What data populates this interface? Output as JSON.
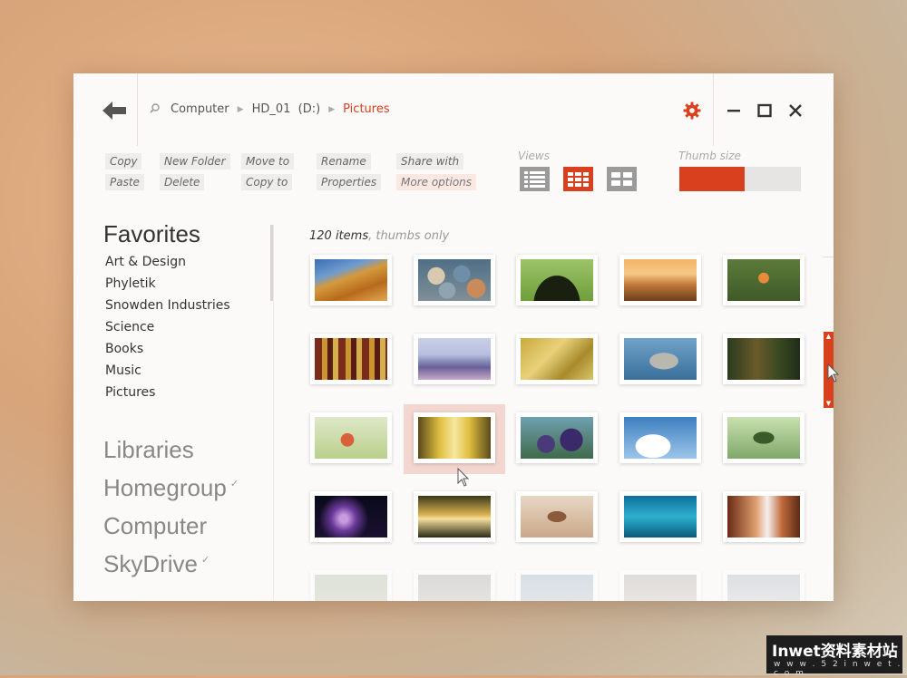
{
  "window": {
    "breadcrumb": [
      "Computer",
      "HD_01  (D:)",
      "Pictures"
    ],
    "settings_icon": "gear-icon",
    "minimize_icon": "minimize-icon",
    "maximize_icon": "maximize-icon",
    "close_icon": "close-icon",
    "back_icon": "back-arrow-icon",
    "search_icon": "search-icon"
  },
  "toolbar": {
    "copy": "Copy",
    "paste": "Paste",
    "new_folder": "New Folder",
    "delete": "Delete",
    "move_to": "Move to",
    "copy_to": "Copy to",
    "rename": "Rename",
    "properties": "Properties",
    "share_with": "Share with",
    "more_options": "More options",
    "views_label": "Views",
    "views": [
      "list-view-icon",
      "thumbs-view-icon",
      "tiles-view-icon"
    ],
    "selected_view": "thumbs-view-icon",
    "thumb_size_label": "Thumb size",
    "thumb_size_value": 0.54
  },
  "sidebar": {
    "favorites_title": "Favorites",
    "favorites": [
      "Art & Design",
      "Phyletik",
      "Snowden Industries",
      "Science",
      "Books",
      "Music",
      "Pictures"
    ],
    "locations": [
      "Libraries",
      "Homegroup",
      "Computer",
      "SkyDrive"
    ],
    "checks": [
      "",
      "✓",
      "",
      "✓"
    ]
  },
  "content": {
    "count": "120 items",
    "count_suffix": ", thumbs only",
    "selected_index": 11,
    "thumbnails": [
      "wheat",
      "pebbles",
      "birds-silhouette",
      "sunset-lake",
      "mandarin-duck",
      "corn",
      "mountain-lake",
      "grass",
      "seal",
      "deer-forest",
      "peach",
      "autumn-avenue",
      "grapes",
      "sky-clouds",
      "chameleon",
      "nebula",
      "forest-sunset",
      "sparrow",
      "underwater",
      "autumn-road",
      "faded-1",
      "faded-2",
      "faded-3",
      "faded-4",
      "faded-5"
    ]
  },
  "colors": {
    "accent": "#d9401d",
    "selection": "#f3d6cf",
    "inactive_view": "#9a9a9a"
  },
  "watermark": {
    "line1": "Inwet资料素材站",
    "line2": "w w w . 5 2 i n w e t . c o m"
  }
}
